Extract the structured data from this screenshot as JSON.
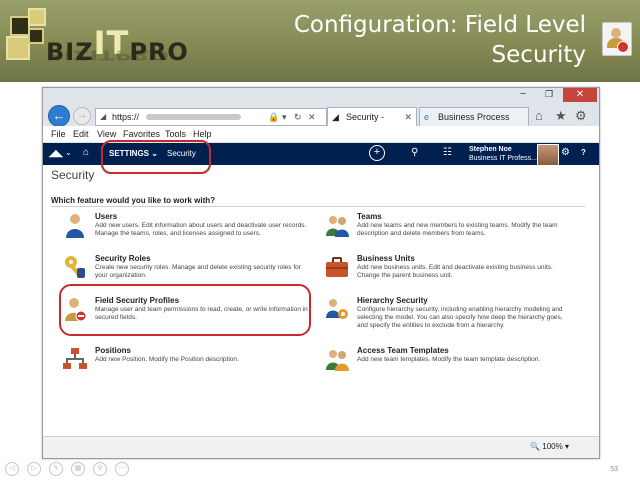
{
  "slide": {
    "title": "Configuration: Field Level Security",
    "logo_biz": "BIZ",
    "logo_it": "IT",
    "logo_pro": "PRO",
    "page_number": "53"
  },
  "browser": {
    "url_prefix": "https://",
    "tabs": [
      {
        "label": "Security - Micros...",
        "active": true
      },
      {
        "label": "Business Process Ma...",
        "active": false
      }
    ],
    "menu": [
      "File",
      "Edit",
      "View",
      "Favorites",
      "Tools",
      "Help"
    ],
    "zoom": "100%"
  },
  "crm": {
    "area": "SETTINGS",
    "subarea": "Security",
    "user_name": "Stephen Noe",
    "user_org": "Business IT Profess...",
    "page_title": "Security",
    "heading": "Which feature would you like to work with?",
    "features": [
      {
        "title": "Users",
        "description": "Add new users. Edit information about users and deactivate user records. Manage the teams, roles, and licenses assigned to users.",
        "icon": "user-icon"
      },
      {
        "title": "Teams",
        "description": "Add new teams and new members to existing teams. Modify the team description and delete members from teams.",
        "icon": "team-icon"
      },
      {
        "title": "Security Roles",
        "description": "Create new security roles. Manage and delete existing security roles for your organization.",
        "icon": "key-icon"
      },
      {
        "title": "Business Units",
        "description": "Add new business units. Edit and deactivate existing business units. Change the parent business unit.",
        "icon": "briefcase-icon"
      },
      {
        "title": "Field Security Profiles",
        "description": "Manage user and team permissions to read, create, or write information in secured fields.",
        "icon": "field-security-icon"
      },
      {
        "title": "Hierarchy Security",
        "description": "Configure hierarchy security, including enabling hierarchy modeling and selecting the model. You can also specify how deep the hierarchy goes, and specify the entities to exclude from a hierarchy.",
        "icon": "hierarchy-security-icon"
      },
      {
        "title": "Positions",
        "description": "Add new Position. Modify the Position description.",
        "icon": "org-chart-icon"
      },
      {
        "title": "Access Team Templates",
        "description": "Add new team templates. Modify the team template description.",
        "icon": "access-team-icon"
      }
    ]
  },
  "colors": {
    "header_band": "#858a55",
    "crm_nav": "#002050",
    "highlight": "#c62a2a",
    "close": "#c7453a",
    "back_button": "#2f7bd0"
  }
}
